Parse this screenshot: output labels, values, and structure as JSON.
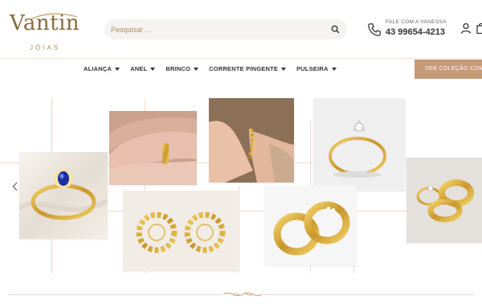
{
  "brand": {
    "name": "Vantin",
    "subtitle": "JÓIAS"
  },
  "search": {
    "placeholder": "Pesquisar ..."
  },
  "contact": {
    "label": "FALE COM A VANESSA",
    "number": "43 99654-4213"
  },
  "nav": {
    "items": [
      {
        "label": "ALIANÇA"
      },
      {
        "label": "ANEL"
      },
      {
        "label": "BRINCO"
      },
      {
        "label": "CORRENTE PINGENTE"
      },
      {
        "label": "PULSEIRA"
      }
    ],
    "cta_label": "VER COLEÇÃO COM"
  },
  "colors": {
    "brand_gold": "#b08c5b",
    "accent": "#c59a78",
    "guide": "#f3d6c7"
  },
  "icons": [
    "search-icon",
    "phone-icon",
    "user-icon",
    "bag-icon",
    "chevron-left-icon"
  ]
}
